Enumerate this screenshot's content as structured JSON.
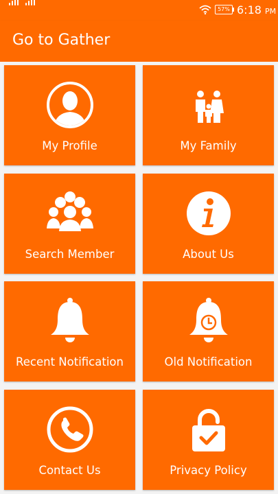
{
  "status_bar": {
    "battery": "57",
    "time": "6:18",
    "ampm": "PM"
  },
  "app_bar": {
    "title": "Go to Gather"
  },
  "tiles": [
    {
      "label": "My Profile",
      "icon": "profile-icon"
    },
    {
      "label": "My Family",
      "icon": "family-icon"
    },
    {
      "label": "Search Member",
      "icon": "group-icon"
    },
    {
      "label": "About Us",
      "icon": "info-icon"
    },
    {
      "label": "Recent Notification",
      "icon": "bell-icon"
    },
    {
      "label": "Old Notification",
      "icon": "bell-clock-icon"
    },
    {
      "label": "Contact Us",
      "icon": "phone-icon"
    },
    {
      "label": "Privacy Policy",
      "icon": "lock-check-icon"
    }
  ],
  "colors": {
    "accent": "#ff6a00",
    "tile_gap": "#f3f3f3",
    "text": "#ffffff"
  }
}
